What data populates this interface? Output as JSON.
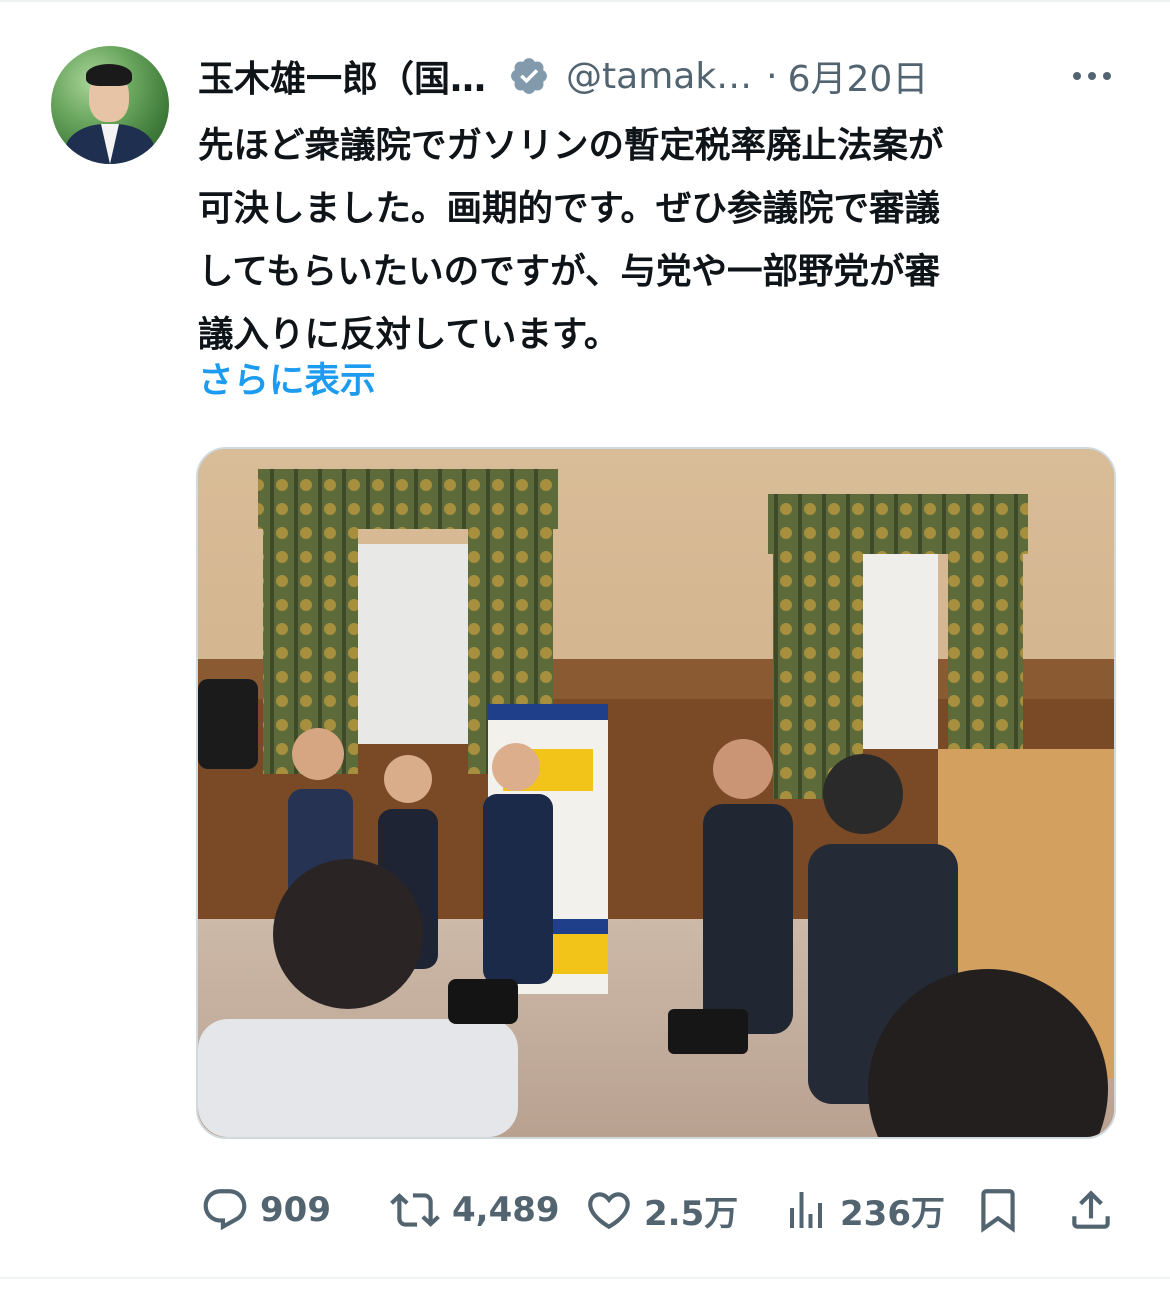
{
  "author": {
    "name": "玉木雄一郎（国…",
    "handle": "@tamak…",
    "separator": "·",
    "date": "6月20日",
    "verified": true
  },
  "tweet": {
    "lines": [
      "先ほど衆議院でガソリンの暫定税率廃止法案が",
      "可決しました。画期的です。ぜひ参議院で審議",
      "してもらいたいのですが、",
      "議入りに反対しています。"
    ],
    "line3_bold": "与党",
    "line3_rest": "や一部野党が審",
    "show_more": "さらに表示"
  },
  "metrics": {
    "replies": "909",
    "reposts": "4,489",
    "likes": "2.5万",
    "views": "236万"
  },
  "colors": {
    "text": "#0f1419",
    "secondary": "#536471",
    "link": "#1d9bf0",
    "border": "#cfd9de"
  },
  "icons": {
    "verified": "verified-badge-icon",
    "more": "more-dots-icon",
    "reply": "reply-icon",
    "repost": "repost-icon",
    "like": "heart-icon",
    "views": "views-chart-icon",
    "bookmark": "bookmark-icon",
    "share": "share-icon"
  }
}
